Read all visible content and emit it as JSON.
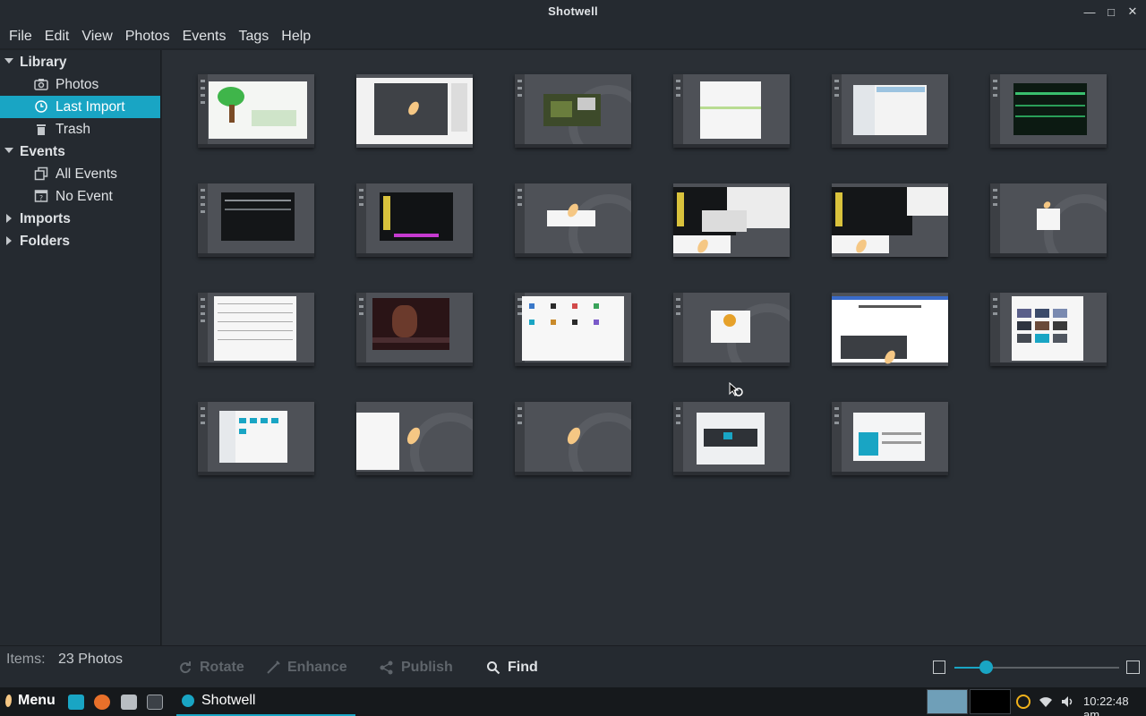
{
  "window": {
    "title": "Shotwell",
    "controls": {
      "minimize": "—",
      "maximize": "□",
      "close": "✕"
    }
  },
  "menubar": [
    "File",
    "Edit",
    "View",
    "Photos",
    "Events",
    "Tags",
    "Help"
  ],
  "sidebar": {
    "library": {
      "label": "Library",
      "items": [
        "Photos",
        "Last Import",
        "Trash"
      ]
    },
    "events": {
      "label": "Events",
      "items": [
        "All Events",
        "No Event"
      ]
    },
    "imports": "Imports",
    "folders": "Folders"
  },
  "status": {
    "items_label": "Items:",
    "items_value": "23 Photos",
    "tools": {
      "rotate": "Rotate",
      "enhance": "Enhance",
      "publish": "Publish",
      "find": "Find"
    },
    "zoom_level": 0.19
  },
  "thumbnail_count": 23,
  "taskbar": {
    "menu_label": "Menu",
    "task_label": "Shotwell",
    "clock": "10:22:48 am"
  },
  "colors": {
    "accent": "#19a5c4",
    "leaf": "#f5c784",
    "background": "#2a2f35",
    "panel": "#252a30"
  }
}
